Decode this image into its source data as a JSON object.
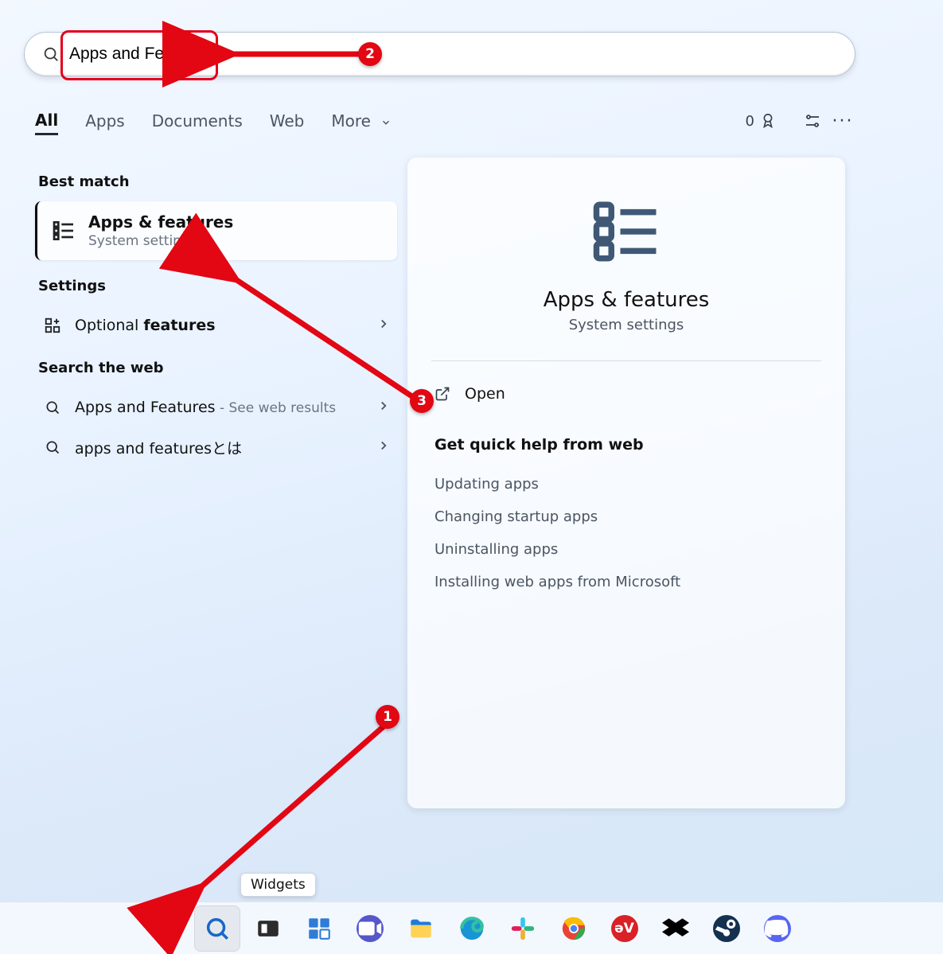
{
  "search": {
    "value": "Apps and Features"
  },
  "tabs": {
    "all": "All",
    "apps": "Apps",
    "documents": "Documents",
    "web": "Web",
    "more": "More",
    "rewards_count": "0"
  },
  "left": {
    "best_match_heading": "Best match",
    "best_match_title": "Apps & features",
    "best_match_sub": "System settings",
    "settings_heading": "Settings",
    "optional_pre": "Optional ",
    "optional_bold": "features",
    "web_heading": "Search the web",
    "web_1_text": "Apps and Features",
    "web_1_suffix": " - See web results",
    "web_2_text": "apps and featuresとは"
  },
  "right": {
    "title": "Apps & features",
    "sub": "System settings",
    "open": "Open",
    "help_heading": "Get quick help from web",
    "links": {
      "a": "Updating apps",
      "b": "Changing startup apps",
      "c": "Uninstalling apps",
      "d": "Installing web apps from Microsoft"
    }
  },
  "tooltip": "Widgets",
  "annotations": {
    "n1": "1",
    "n2": "2",
    "n3": "3"
  }
}
